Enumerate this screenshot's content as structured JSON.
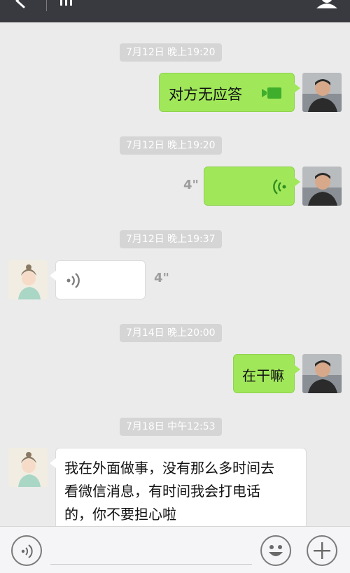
{
  "topbar": {
    "icons": [
      "back-arrow-icon",
      "signal-bars-icon",
      "person-icon"
    ]
  },
  "messages": [
    {
      "type": "timestamp",
      "text": "7月12日 晚上19:20"
    },
    {
      "type": "outgoing-video-call",
      "text": "对方无应答",
      "icon": "video-camera-icon"
    },
    {
      "type": "timestamp",
      "text": "7月12日 晚上19:20"
    },
    {
      "type": "outgoing-voice",
      "duration": "4\"",
      "icon": "voice-wave-icon"
    },
    {
      "type": "timestamp",
      "text": "7月12日 晚上19:37"
    },
    {
      "type": "incoming-voice",
      "duration": "4\"",
      "icon": "voice-wave-icon"
    },
    {
      "type": "timestamp",
      "text": "7月14日 晚上20:00"
    },
    {
      "type": "outgoing-text",
      "text": "在干嘛"
    },
    {
      "type": "timestamp",
      "text": "7月18日 中午12:53"
    },
    {
      "type": "incoming-text",
      "lines": [
        "我在外面做事，没有那么多时间去",
        "看微信消息，有时间我会打电话",
        "的，你不要担心啦"
      ]
    }
  ],
  "bottombar": {
    "icons": [
      "voice-input-icon",
      "emoji-icon",
      "plus-icon"
    ]
  },
  "colors": {
    "topbar": "#393a3f",
    "background": "#ebebeb",
    "outgoing_bubble": "#a0e75a",
    "incoming_bubble": "#ffffff",
    "timestamp_bg": "#d5d5d5"
  }
}
